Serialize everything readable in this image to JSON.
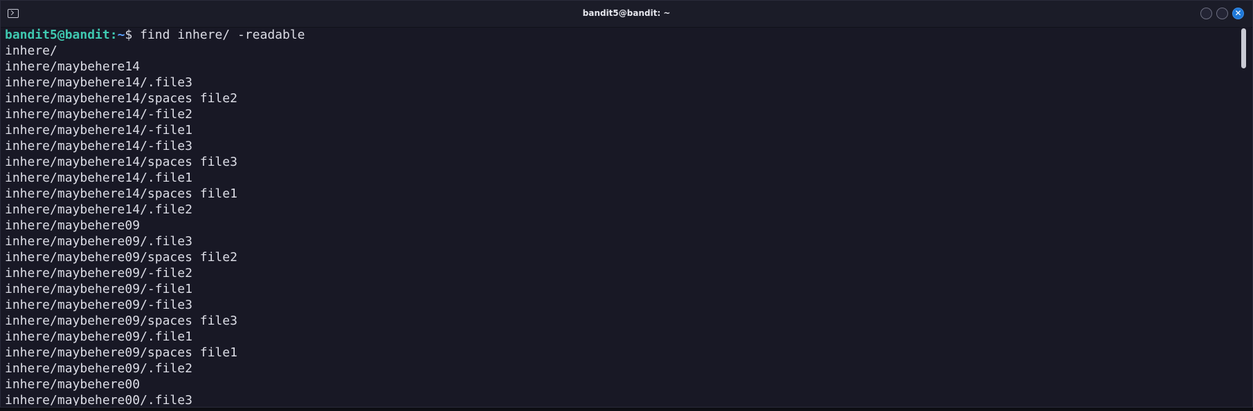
{
  "window": {
    "title": "bandit5@bandit: ~",
    "icon": "terminal-icon",
    "close_glyph": "✕"
  },
  "prompt": {
    "user_host": "bandit5@bandit",
    "separator": ":",
    "path": "~",
    "symbol": "$ ",
    "command": "find inhere/ -readable"
  },
  "output_lines": [
    "inhere/",
    "inhere/maybehere14",
    "inhere/maybehere14/.file3",
    "inhere/maybehere14/spaces file2",
    "inhere/maybehere14/-file2",
    "inhere/maybehere14/-file1",
    "inhere/maybehere14/-file3",
    "inhere/maybehere14/spaces file3",
    "inhere/maybehere14/.file1",
    "inhere/maybehere14/spaces file1",
    "inhere/maybehere14/.file2",
    "inhere/maybehere09",
    "inhere/maybehere09/.file3",
    "inhere/maybehere09/spaces file2",
    "inhere/maybehere09/-file2",
    "inhere/maybehere09/-file1",
    "inhere/maybehere09/-file3",
    "inhere/maybehere09/spaces file3",
    "inhere/maybehere09/.file1",
    "inhere/maybehere09/spaces file1",
    "inhere/maybehere09/.file2",
    "inhere/maybehere00",
    "inhere/maybehere00/.file3"
  ],
  "colors": {
    "background": "#181825",
    "text": "#dcdde6",
    "prompt_user": "#3fc8b0",
    "prompt_path": "#5aa0ff",
    "close_button": "#1e78d8"
  },
  "scroll_position": 0.0
}
